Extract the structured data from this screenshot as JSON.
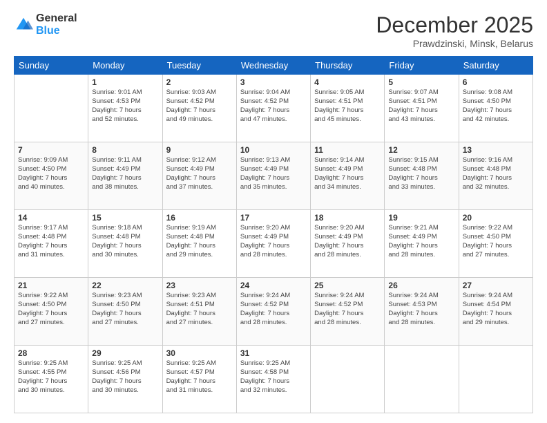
{
  "logo": {
    "general": "General",
    "blue": "Blue"
  },
  "header": {
    "month": "December 2025",
    "location": "Prawdzinski, Minsk, Belarus"
  },
  "weekdays": [
    "Sunday",
    "Monday",
    "Tuesday",
    "Wednesday",
    "Thursday",
    "Friday",
    "Saturday"
  ],
  "weeks": [
    [
      {
        "day": "",
        "info": ""
      },
      {
        "day": "1",
        "info": "Sunrise: 9:01 AM\nSunset: 4:53 PM\nDaylight: 7 hours\nand 52 minutes."
      },
      {
        "day": "2",
        "info": "Sunrise: 9:03 AM\nSunset: 4:52 PM\nDaylight: 7 hours\nand 49 minutes."
      },
      {
        "day": "3",
        "info": "Sunrise: 9:04 AM\nSunset: 4:52 PM\nDaylight: 7 hours\nand 47 minutes."
      },
      {
        "day": "4",
        "info": "Sunrise: 9:05 AM\nSunset: 4:51 PM\nDaylight: 7 hours\nand 45 minutes."
      },
      {
        "day": "5",
        "info": "Sunrise: 9:07 AM\nSunset: 4:51 PM\nDaylight: 7 hours\nand 43 minutes."
      },
      {
        "day": "6",
        "info": "Sunrise: 9:08 AM\nSunset: 4:50 PM\nDaylight: 7 hours\nand 42 minutes."
      }
    ],
    [
      {
        "day": "7",
        "info": "Sunrise: 9:09 AM\nSunset: 4:50 PM\nDaylight: 7 hours\nand 40 minutes."
      },
      {
        "day": "8",
        "info": "Sunrise: 9:11 AM\nSunset: 4:49 PM\nDaylight: 7 hours\nand 38 minutes."
      },
      {
        "day": "9",
        "info": "Sunrise: 9:12 AM\nSunset: 4:49 PM\nDaylight: 7 hours\nand 37 minutes."
      },
      {
        "day": "10",
        "info": "Sunrise: 9:13 AM\nSunset: 4:49 PM\nDaylight: 7 hours\nand 35 minutes."
      },
      {
        "day": "11",
        "info": "Sunrise: 9:14 AM\nSunset: 4:49 PM\nDaylight: 7 hours\nand 34 minutes."
      },
      {
        "day": "12",
        "info": "Sunrise: 9:15 AM\nSunset: 4:48 PM\nDaylight: 7 hours\nand 33 minutes."
      },
      {
        "day": "13",
        "info": "Sunrise: 9:16 AM\nSunset: 4:48 PM\nDaylight: 7 hours\nand 32 minutes."
      }
    ],
    [
      {
        "day": "14",
        "info": "Sunrise: 9:17 AM\nSunset: 4:48 PM\nDaylight: 7 hours\nand 31 minutes."
      },
      {
        "day": "15",
        "info": "Sunrise: 9:18 AM\nSunset: 4:48 PM\nDaylight: 7 hours\nand 30 minutes."
      },
      {
        "day": "16",
        "info": "Sunrise: 9:19 AM\nSunset: 4:48 PM\nDaylight: 7 hours\nand 29 minutes."
      },
      {
        "day": "17",
        "info": "Sunrise: 9:20 AM\nSunset: 4:49 PM\nDaylight: 7 hours\nand 28 minutes."
      },
      {
        "day": "18",
        "info": "Sunrise: 9:20 AM\nSunset: 4:49 PM\nDaylight: 7 hours\nand 28 minutes."
      },
      {
        "day": "19",
        "info": "Sunrise: 9:21 AM\nSunset: 4:49 PM\nDaylight: 7 hours\nand 28 minutes."
      },
      {
        "day": "20",
        "info": "Sunrise: 9:22 AM\nSunset: 4:50 PM\nDaylight: 7 hours\nand 27 minutes."
      }
    ],
    [
      {
        "day": "21",
        "info": "Sunrise: 9:22 AM\nSunset: 4:50 PM\nDaylight: 7 hours\nand 27 minutes."
      },
      {
        "day": "22",
        "info": "Sunrise: 9:23 AM\nSunset: 4:50 PM\nDaylight: 7 hours\nand 27 minutes."
      },
      {
        "day": "23",
        "info": "Sunrise: 9:23 AM\nSunset: 4:51 PM\nDaylight: 7 hours\nand 27 minutes."
      },
      {
        "day": "24",
        "info": "Sunrise: 9:24 AM\nSunset: 4:52 PM\nDaylight: 7 hours\nand 28 minutes."
      },
      {
        "day": "25",
        "info": "Sunrise: 9:24 AM\nSunset: 4:52 PM\nDaylight: 7 hours\nand 28 minutes."
      },
      {
        "day": "26",
        "info": "Sunrise: 9:24 AM\nSunset: 4:53 PM\nDaylight: 7 hours\nand 28 minutes."
      },
      {
        "day": "27",
        "info": "Sunrise: 9:24 AM\nSunset: 4:54 PM\nDaylight: 7 hours\nand 29 minutes."
      }
    ],
    [
      {
        "day": "28",
        "info": "Sunrise: 9:25 AM\nSunset: 4:55 PM\nDaylight: 7 hours\nand 30 minutes."
      },
      {
        "day": "29",
        "info": "Sunrise: 9:25 AM\nSunset: 4:56 PM\nDaylight: 7 hours\nand 30 minutes."
      },
      {
        "day": "30",
        "info": "Sunrise: 9:25 AM\nSunset: 4:57 PM\nDaylight: 7 hours\nand 31 minutes."
      },
      {
        "day": "31",
        "info": "Sunrise: 9:25 AM\nSunset: 4:58 PM\nDaylight: 7 hours\nand 32 minutes."
      },
      {
        "day": "",
        "info": ""
      },
      {
        "day": "",
        "info": ""
      },
      {
        "day": "",
        "info": ""
      }
    ]
  ]
}
